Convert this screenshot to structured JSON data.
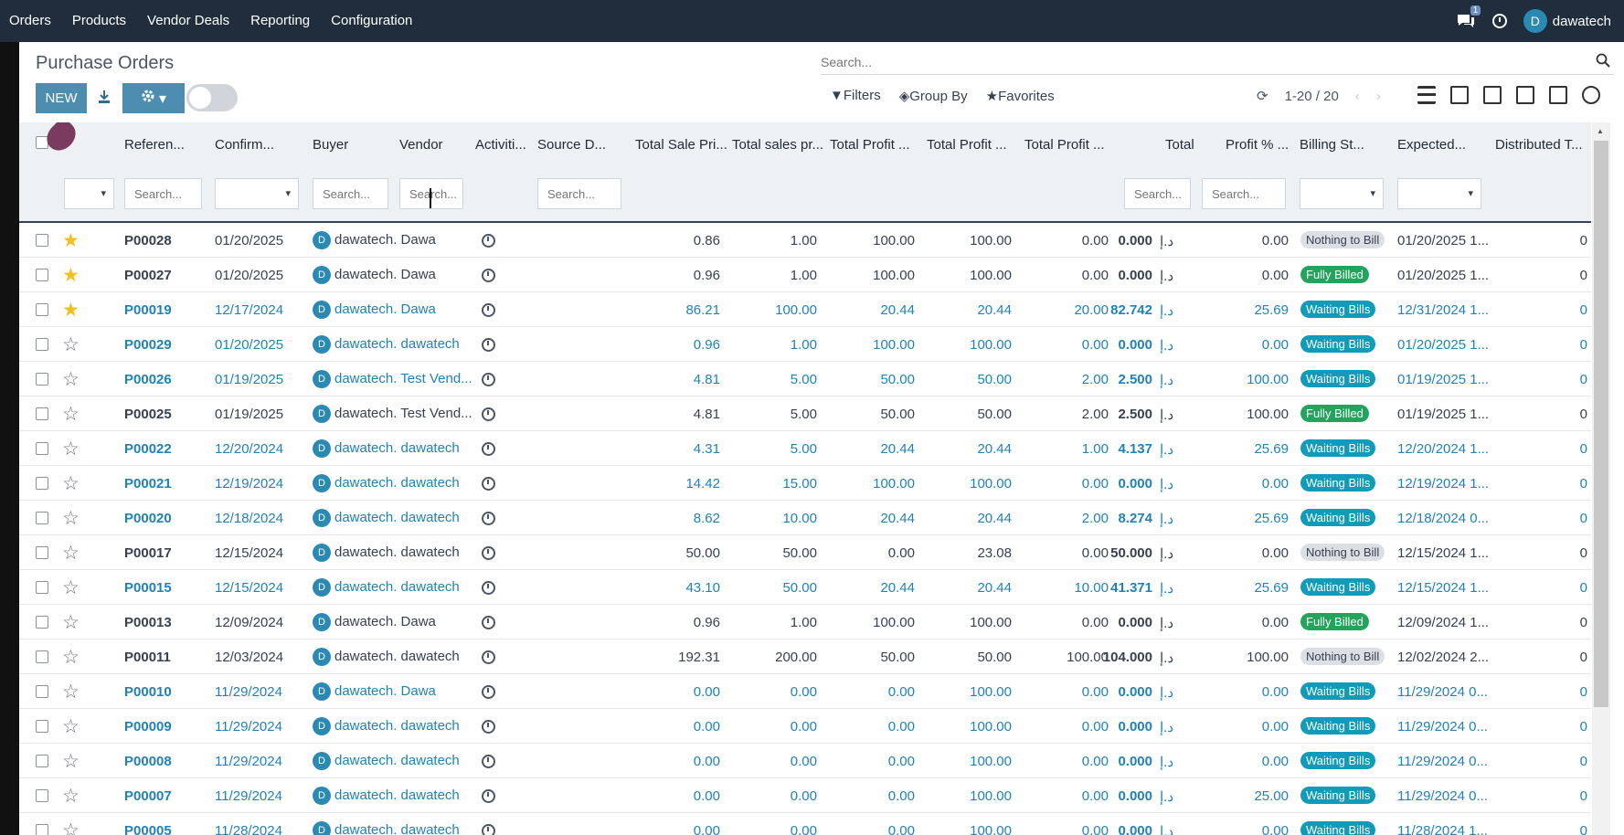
{
  "topbar": {
    "menu": [
      "Orders",
      "Products",
      "Vendor Deals",
      "Reporting",
      "Configuration"
    ],
    "chat_badge": "1",
    "user_initial": "D",
    "user_name": "dawatech"
  },
  "control": {
    "title": "Purchase Orders",
    "search_placeholder": "Search...",
    "new_label": "NEW",
    "filters_label": "Filters",
    "groupby_label": "Group By",
    "favorites_label": "Favorites",
    "pager": "1-20 / 20"
  },
  "columns": [
    "Referen...",
    "Confirm...",
    "Buyer",
    "Vendor",
    "Activiti...",
    "Source D...",
    "Total Sale Pri...",
    "Total sales pr...",
    "Total Profit ...",
    "Total Profit ...",
    "Total Profit ...",
    "Total",
    "Profit % ...",
    "Billing St...",
    "Expected...",
    "Distributed T..."
  ],
  "filter_placeholder": "Search...",
  "rows": [
    {
      "ref": "P00028",
      "date": "01/20/2025",
      "buyer": "dawatech.",
      "vendor": "Dawa",
      "tsp": "0.86",
      "tsales": "1.00",
      "tp1": "100.00",
      "tp2": "100.00",
      "tp3": "0.00",
      "total": "0.000",
      "pct": "0.00",
      "billing": "Nothing to Bill",
      "expected": "01/20/2025 1...",
      "dist": "0",
      "fav": true,
      "style": "plain"
    },
    {
      "ref": "P00027",
      "date": "01/20/2025",
      "buyer": "dawatech.",
      "vendor": "Dawa",
      "tsp": "0.96",
      "tsales": "1.00",
      "tp1": "100.00",
      "tp2": "100.00",
      "tp3": "0.00",
      "total": "0.000",
      "pct": "0.00",
      "billing": "Fully Billed",
      "expected": "01/20/2025 1...",
      "dist": "0",
      "fav": true,
      "style": "plain"
    },
    {
      "ref": "P00019",
      "date": "12/17/2024",
      "buyer": "dawatech.",
      "vendor": "Dawa",
      "tsp": "86.21",
      "tsales": "100.00",
      "tp1": "20.44",
      "tp2": "20.44",
      "tp3": "20.00",
      "total": "82.742",
      "pct": "25.69",
      "billing": "Waiting Bills",
      "expected": "12/31/2024 1...",
      "dist": "0",
      "fav": true,
      "style": "blue"
    },
    {
      "ref": "P00029",
      "date": "01/20/2025",
      "buyer": "dawatech.",
      "vendor": "dawatech",
      "tsp": "0.96",
      "tsales": "1.00",
      "tp1": "100.00",
      "tp2": "100.00",
      "tp3": "0.00",
      "total": "0.000",
      "pct": "0.00",
      "billing": "Waiting Bills",
      "expected": "01/20/2025 1...",
      "dist": "0",
      "fav": false,
      "style": "blue"
    },
    {
      "ref": "P00026",
      "date": "01/19/2025",
      "buyer": "dawatech.",
      "vendor": "Test Vend...",
      "tsp": "4.81",
      "tsales": "5.00",
      "tp1": "50.00",
      "tp2": "50.00",
      "tp3": "2.00",
      "total": "2.500",
      "pct": "100.00",
      "billing": "Waiting Bills",
      "expected": "01/19/2025 1...",
      "dist": "0",
      "fav": false,
      "style": "blue"
    },
    {
      "ref": "P00025",
      "date": "01/19/2025",
      "buyer": "dawatech.",
      "vendor": "Test Vend...",
      "tsp": "4.81",
      "tsales": "5.00",
      "tp1": "50.00",
      "tp2": "50.00",
      "tp3": "2.00",
      "total": "2.500",
      "pct": "100.00",
      "billing": "Fully Billed",
      "expected": "01/19/2025 1...",
      "dist": "0",
      "fav": false,
      "style": "plain"
    },
    {
      "ref": "P00022",
      "date": "12/20/2024",
      "buyer": "dawatech.",
      "vendor": "dawatech",
      "tsp": "4.31",
      "tsales": "5.00",
      "tp1": "20.44",
      "tp2": "20.44",
      "tp3": "1.00",
      "total": "4.137",
      "pct": "25.69",
      "billing": "Waiting Bills",
      "expected": "12/20/2024 1...",
      "dist": "0",
      "fav": false,
      "style": "blue"
    },
    {
      "ref": "P00021",
      "date": "12/19/2024",
      "buyer": "dawatech.",
      "vendor": "dawatech",
      "tsp": "14.42",
      "tsales": "15.00",
      "tp1": "100.00",
      "tp2": "100.00",
      "tp3": "0.00",
      "total": "0.000",
      "pct": "0.00",
      "billing": "Waiting Bills",
      "expected": "12/19/2024 1...",
      "dist": "0",
      "fav": false,
      "style": "blue"
    },
    {
      "ref": "P00020",
      "date": "12/18/2024",
      "buyer": "dawatech.",
      "vendor": "dawatech",
      "tsp": "8.62",
      "tsales": "10.00",
      "tp1": "20.44",
      "tp2": "20.44",
      "tp3": "2.00",
      "total": "8.274",
      "pct": "25.69",
      "billing": "Waiting Bills",
      "expected": "12/18/2024 0...",
      "dist": "0",
      "fav": false,
      "style": "blue"
    },
    {
      "ref": "P00017",
      "date": "12/15/2024",
      "buyer": "dawatech.",
      "vendor": "dawatech",
      "tsp": "50.00",
      "tsales": "50.00",
      "tp1": "0.00",
      "tp2": "23.08",
      "tp3": "0.00",
      "total": "50.000",
      "pct": "0.00",
      "billing": "Nothing to Bill",
      "expected": "12/15/2024 1...",
      "dist": "0",
      "fav": false,
      "style": "plain"
    },
    {
      "ref": "P00015",
      "date": "12/15/2024",
      "buyer": "dawatech.",
      "vendor": "dawatech",
      "tsp": "43.10",
      "tsales": "50.00",
      "tp1": "20.44",
      "tp2": "20.44",
      "tp3": "10.00",
      "total": "41.371",
      "pct": "25.69",
      "billing": "Waiting Bills",
      "expected": "12/15/2024 1...",
      "dist": "0",
      "fav": false,
      "style": "blue"
    },
    {
      "ref": "P00013",
      "date": "12/09/2024",
      "buyer": "dawatech.",
      "vendor": "Dawa",
      "tsp": "0.96",
      "tsales": "1.00",
      "tp1": "100.00",
      "tp2": "100.00",
      "tp3": "0.00",
      "total": "0.000",
      "pct": "0.00",
      "billing": "Fully Billed",
      "expected": "12/09/2024 1...",
      "dist": "0",
      "fav": false,
      "style": "plain"
    },
    {
      "ref": "P00011",
      "date": "12/03/2024",
      "buyer": "dawatech.",
      "vendor": "dawatech",
      "tsp": "192.31",
      "tsales": "200.00",
      "tp1": "50.00",
      "tp2": "50.00",
      "tp3": "100.00",
      "total": "104.000",
      "pct": "100.00",
      "billing": "Nothing to Bill",
      "expected": "12/02/2024 2...",
      "dist": "0",
      "fav": false,
      "style": "plain"
    },
    {
      "ref": "P00010",
      "date": "11/29/2024",
      "buyer": "dawatech.",
      "vendor": "Dawa",
      "tsp": "0.00",
      "tsales": "0.00",
      "tp1": "0.00",
      "tp2": "100.00",
      "tp3": "0.00",
      "total": "0.000",
      "pct": "0.00",
      "billing": "Waiting Bills",
      "expected": "11/29/2024 0...",
      "dist": "0",
      "fav": false,
      "style": "blue"
    },
    {
      "ref": "P00009",
      "date": "11/29/2024",
      "buyer": "dawatech.",
      "vendor": "dawatech",
      "tsp": "0.00",
      "tsales": "0.00",
      "tp1": "0.00",
      "tp2": "100.00",
      "tp3": "0.00",
      "total": "0.000",
      "pct": "0.00",
      "billing": "Waiting Bills",
      "expected": "11/29/2024 0...",
      "dist": "0",
      "fav": false,
      "style": "blue"
    },
    {
      "ref": "P00008",
      "date": "11/29/2024",
      "buyer": "dawatech.",
      "vendor": "dawatech",
      "tsp": "0.00",
      "tsales": "0.00",
      "tp1": "0.00",
      "tp2": "100.00",
      "tp3": "0.00",
      "total": "0.000",
      "pct": "0.00",
      "billing": "Waiting Bills",
      "expected": "11/29/2024 0...",
      "dist": "0",
      "fav": false,
      "style": "blue"
    },
    {
      "ref": "P00007",
      "date": "11/29/2024",
      "buyer": "dawatech.",
      "vendor": "dawatech",
      "tsp": "0.00",
      "tsales": "0.00",
      "tp1": "0.00",
      "tp2": "100.00",
      "tp3": "0.00",
      "total": "0.000",
      "pct": "25.00",
      "billing": "Waiting Bills",
      "expected": "11/29/2024 0...",
      "dist": "0",
      "fav": false,
      "style": "blue"
    },
    {
      "ref": "P00005",
      "date": "11/28/2024",
      "buyer": "dawatech.",
      "vendor": "dawatech",
      "tsp": "0.00",
      "tsales": "0.00",
      "tp1": "0.00",
      "tp2": "100.00",
      "tp3": "0.00",
      "total": "0.000",
      "pct": "0.00",
      "billing": "Waiting Bills",
      "expected": "11/28/2024 1...",
      "dist": "0",
      "fav": false,
      "style": "blue"
    }
  ],
  "currency": "د.إ",
  "avatar_initial": "D",
  "colors": {
    "topbar": "#1f2d3d",
    "accent": "#4d8eb0",
    "waiting": "#0f9bb9",
    "fully_billed": "#22a45d"
  }
}
